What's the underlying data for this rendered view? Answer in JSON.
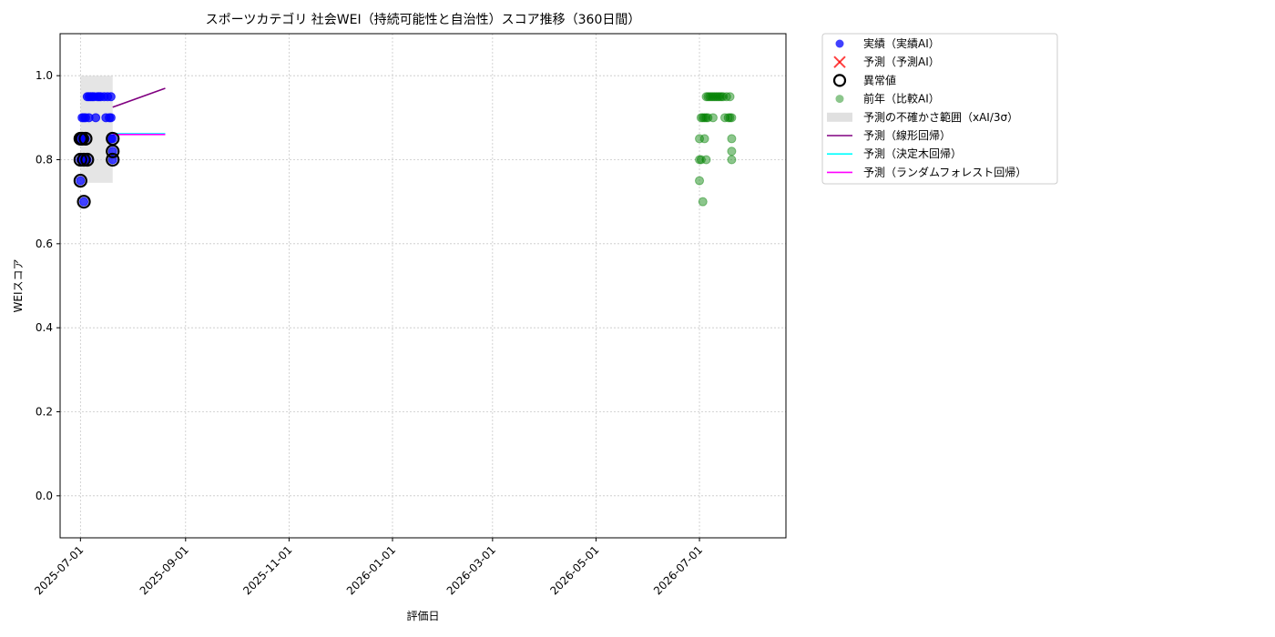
{
  "chart_data": {
    "type": "scatter",
    "title": "スポーツカテゴリ 社会WEI（持続可能性と自治性）スコア推移（360日間）",
    "xlabel": "評価日",
    "ylabel": "WEIスコア",
    "xlim": [
      "2025-06-19",
      "2026-08-21"
    ],
    "ylim": [
      -0.1,
      1.1
    ],
    "x_ticks": [
      "2025-07-01",
      "2025-09-01",
      "2025-11-01",
      "2026-01-01",
      "2026-03-01",
      "2026-05-01",
      "2026-07-01"
    ],
    "y_ticks": [
      0.0,
      0.2,
      0.4,
      0.6,
      0.8,
      1.0
    ],
    "y_tick_labels": [
      "0.0",
      "0.2",
      "0.4",
      "0.6",
      "0.8",
      "1.0"
    ],
    "grid": true,
    "legend_position": "outside-right-top",
    "uncertainty_band": {
      "name": "予測の不確かさ範囲（xAI/3σ）",
      "x_start": "2025-07-01",
      "x_end": "2025-07-20",
      "y_low": 0.745,
      "y_high": 1.0,
      "color": "#d3d3d3"
    },
    "series": [
      {
        "name": "実績（実績AI）",
        "kind": "scatter",
        "color": "#0000ff",
        "points": [
          [
            "2025-07-01",
            0.85
          ],
          [
            "2025-07-01",
            0.8
          ],
          [
            "2025-07-01",
            0.75
          ],
          [
            "2025-07-02",
            0.9
          ],
          [
            "2025-07-02",
            0.85
          ],
          [
            "2025-07-02",
            0.8
          ],
          [
            "2025-07-03",
            0.7
          ],
          [
            "2025-07-03",
            0.9
          ],
          [
            "2025-07-03",
            0.85
          ],
          [
            "2025-07-04",
            0.9
          ],
          [
            "2025-07-04",
            0.85
          ],
          [
            "2025-07-04",
            0.8
          ],
          [
            "2025-07-05",
            0.95
          ],
          [
            "2025-07-05",
            0.8
          ],
          [
            "2025-07-06",
            0.95
          ],
          [
            "2025-07-06",
            0.9
          ],
          [
            "2025-07-07",
            0.95
          ],
          [
            "2025-07-08",
            0.95
          ],
          [
            "2025-07-09",
            0.95
          ],
          [
            "2025-07-10",
            0.9
          ],
          [
            "2025-07-11",
            0.95
          ],
          [
            "2025-07-12",
            0.95
          ],
          [
            "2025-07-13",
            0.95
          ],
          [
            "2025-07-15",
            0.95
          ],
          [
            "2025-07-16",
            0.9
          ],
          [
            "2025-07-17",
            0.95
          ],
          [
            "2025-07-18",
            0.9
          ],
          [
            "2025-07-19",
            0.95
          ],
          [
            "2025-07-19",
            0.9
          ],
          [
            "2025-07-19",
            0.85
          ],
          [
            "2025-07-20",
            0.85
          ],
          [
            "2025-07-20",
            0.82
          ],
          [
            "2025-07-20",
            0.8
          ]
        ]
      },
      {
        "name": "予測（予測AI）",
        "kind": "scatter",
        "color": "#ff0000",
        "points": []
      },
      {
        "name": "異常値",
        "kind": "outlier",
        "color": "#000000",
        "points": [
          [
            "2025-07-01",
            0.85
          ],
          [
            "2025-07-01",
            0.8
          ],
          [
            "2025-07-01",
            0.75
          ],
          [
            "2025-07-02",
            0.85
          ],
          [
            "2025-07-03",
            0.7
          ],
          [
            "2025-07-03",
            0.8
          ],
          [
            "2025-07-04",
            0.85
          ],
          [
            "2025-07-05",
            0.8
          ],
          [
            "2025-07-20",
            0.85
          ],
          [
            "2025-07-20",
            0.82
          ],
          [
            "2025-07-20",
            0.8
          ]
        ]
      },
      {
        "name": "前年（比較AI）",
        "kind": "scatter",
        "color": "#008000",
        "points": [
          [
            "2026-07-01",
            0.85
          ],
          [
            "2026-07-01",
            0.8
          ],
          [
            "2026-07-01",
            0.75
          ],
          [
            "2026-07-02",
            0.9
          ],
          [
            "2026-07-02",
            0.8
          ],
          [
            "2026-07-03",
            0.9
          ],
          [
            "2026-07-03",
            0.7
          ],
          [
            "2026-07-04",
            0.9
          ],
          [
            "2026-07-04",
            0.85
          ],
          [
            "2026-07-05",
            0.95
          ],
          [
            "2026-07-05",
            0.9
          ],
          [
            "2026-07-05",
            0.8
          ],
          [
            "2026-07-06",
            0.95
          ],
          [
            "2026-07-06",
            0.9
          ],
          [
            "2026-07-07",
            0.95
          ],
          [
            "2026-07-08",
            0.95
          ],
          [
            "2026-07-09",
            0.95
          ],
          [
            "2026-07-09",
            0.9
          ],
          [
            "2026-07-10",
            0.95
          ],
          [
            "2026-07-11",
            0.95
          ],
          [
            "2026-07-12",
            0.95
          ],
          [
            "2026-07-13",
            0.95
          ],
          [
            "2026-07-14",
            0.95
          ],
          [
            "2026-07-15",
            0.95
          ],
          [
            "2026-07-16",
            0.9
          ],
          [
            "2026-07-17",
            0.95
          ],
          [
            "2026-07-18",
            0.9
          ],
          [
            "2026-07-19",
            0.95
          ],
          [
            "2026-07-19",
            0.9
          ],
          [
            "2026-07-20",
            0.9
          ],
          [
            "2026-07-20",
            0.85
          ],
          [
            "2026-07-20",
            0.82
          ],
          [
            "2026-07-20",
            0.8
          ]
        ]
      },
      {
        "name": "予測（線形回帰）",
        "kind": "line",
        "color": "#800080",
        "points": [
          [
            "2025-07-20",
            0.925
          ],
          [
            "2025-08-20",
            0.97
          ]
        ]
      },
      {
        "name": "予測（決定木回帰）",
        "kind": "line",
        "color": "#00ffff",
        "points": [
          [
            "2025-07-20",
            0.862
          ],
          [
            "2025-08-20",
            0.862
          ]
        ]
      },
      {
        "name": "予測（ランダムフォレスト回帰）",
        "kind": "line",
        "color": "#ff00ff",
        "points": [
          [
            "2025-07-20",
            0.86
          ],
          [
            "2025-08-20",
            0.86
          ]
        ]
      }
    ]
  }
}
